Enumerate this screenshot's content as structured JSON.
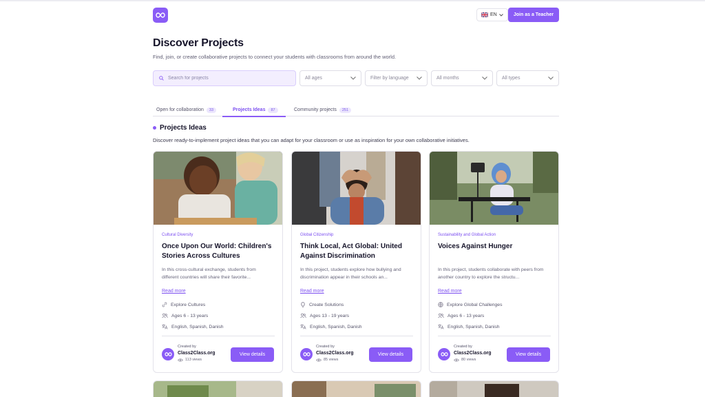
{
  "header": {
    "language": "EN",
    "join_label": "Join as a Teacher"
  },
  "page": {
    "title": "Discover Projects",
    "subtitle": "Find, join, or create collaborative projects to connect your students with classrooms from around the world."
  },
  "filters": {
    "search_placeholder": "Search for projects",
    "ages": "All ages",
    "language": "Filter by language",
    "months": "All months",
    "types": "All types"
  },
  "tabs": [
    {
      "label": "Open for collaboration",
      "count": "33"
    },
    {
      "label": "Projects Ideas",
      "count": "87"
    },
    {
      "label": "Community projects",
      "count": "251"
    }
  ],
  "section": {
    "title": "Projects Ideas",
    "description": "Discover ready-to-implement project ideas that you can adapt for your classroom or use as inspiration for your own collaborative initiatives."
  },
  "cards": [
    {
      "category": "Cultural Diversity",
      "title": "Once Upon Our World: Children's Stories Across Cultures",
      "description": "In this cross-cultural exchange, students from different countries will share their favorite...",
      "read_more": "Read more",
      "goal": "Explore Cultures",
      "ages": "Ages 6 - 13 years",
      "languages": "English, Spanish, Danish",
      "created_by_label": "Created by",
      "creator": "Class2Class.org",
      "views": "113 views",
      "button": "View details"
    },
    {
      "category": "Global Citizenship",
      "title": "Think Local, Act Global: United Against Discrimination",
      "description": "In this project, students explore how bullying and discrimination appear in their schools an...",
      "read_more": "Read more",
      "goal": "Create Solutions",
      "ages": "Ages 13 - 19 years",
      "languages": "English, Spanish, Danish",
      "created_by_label": "Created by",
      "creator": "Class2Class.org",
      "views": "85 views",
      "button": "View details"
    },
    {
      "category": "Sustainability and Global Action",
      "title": "Voices Against Hunger",
      "description": "In this project, students collaborate with peers from another country to explore the structu...",
      "read_more": "Read more",
      "goal": "Explore Global Challenges",
      "ages": "Ages 6 - 13 years",
      "languages": "English, Spanish, Danish",
      "created_by_label": "Created by",
      "creator": "Class2Class.org",
      "views": "80 views",
      "button": "View details"
    }
  ],
  "colors": {
    "accent": "#8a5cf6",
    "accent_text": "#7c4ff0",
    "search_bg": "#f3eefe"
  }
}
